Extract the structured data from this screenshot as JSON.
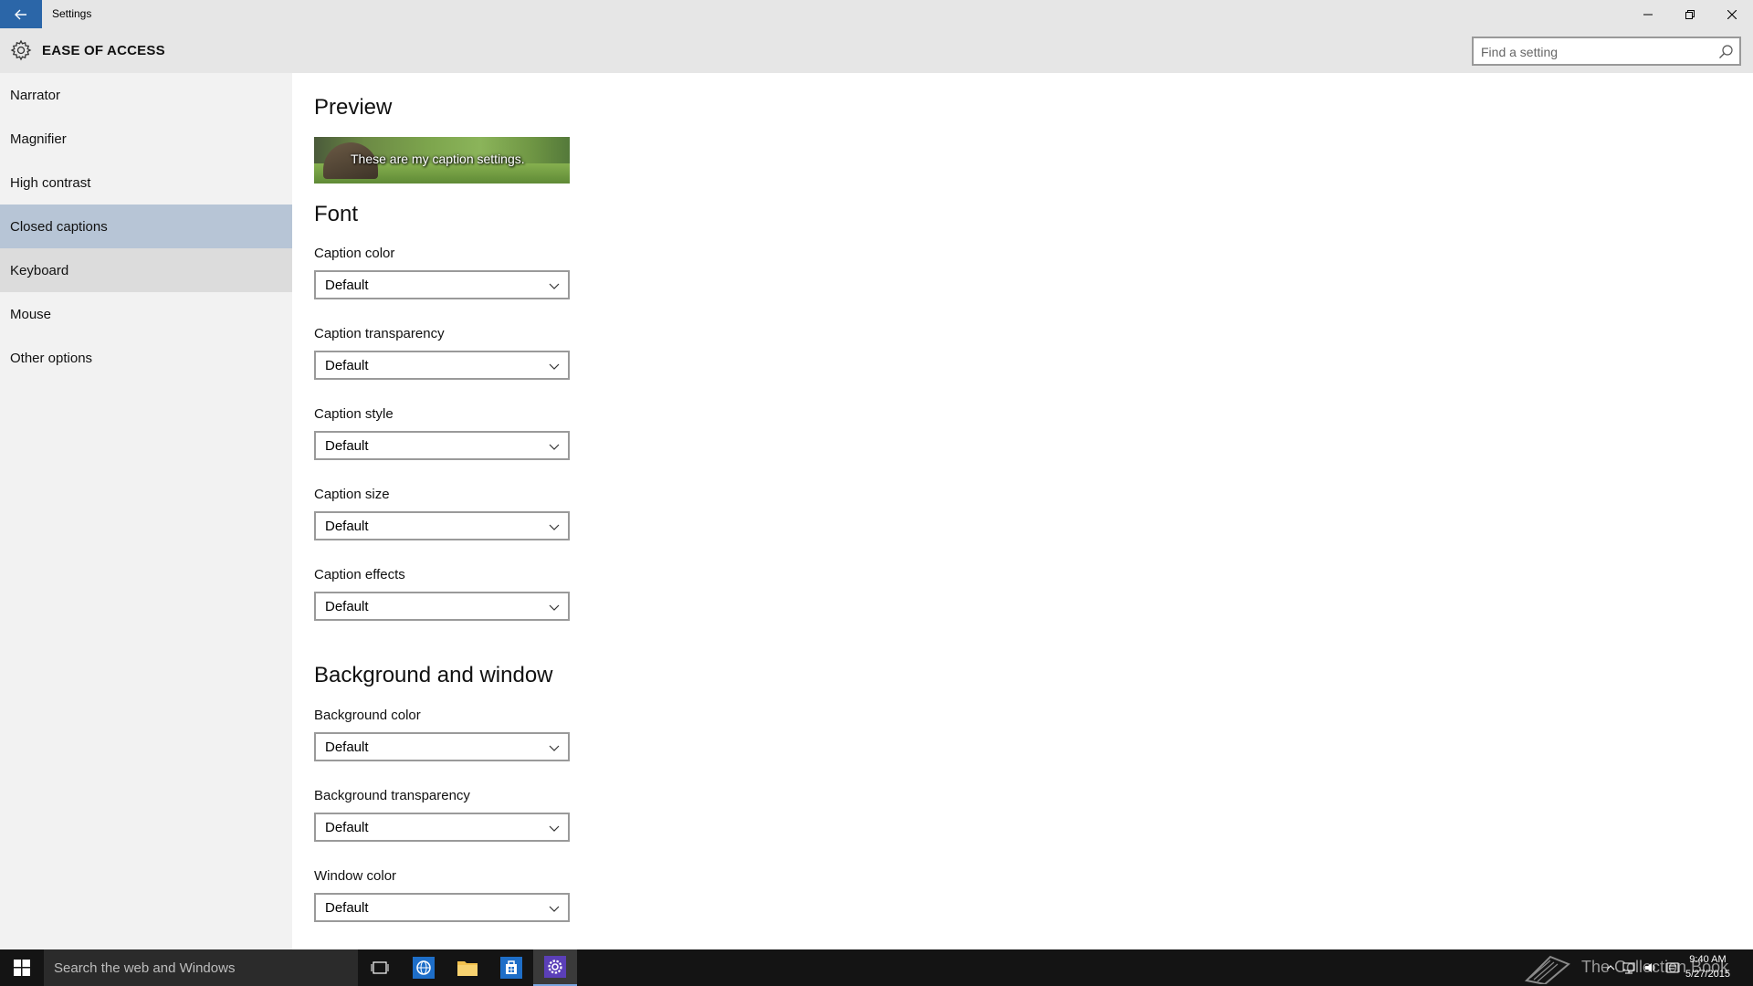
{
  "window": {
    "title": "Settings",
    "back_icon": "back-arrow-icon",
    "controls": [
      "minimize-icon",
      "restore-icon",
      "close-icon"
    ]
  },
  "header": {
    "section_title": "EASE OF ACCESS",
    "icon": "gear-icon",
    "search_placeholder": "Find a setting"
  },
  "sidebar": {
    "items": [
      {
        "label": "Narrator"
      },
      {
        "label": "Magnifier"
      },
      {
        "label": "High contrast"
      },
      {
        "label": "Closed captions",
        "selected": true
      },
      {
        "label": "Keyboard",
        "hover": true
      },
      {
        "label": "Mouse"
      },
      {
        "label": "Other options"
      }
    ]
  },
  "main": {
    "preview_heading": "Preview",
    "preview_caption": "These are my caption settings.",
    "font_heading": "Font",
    "font_fields": [
      {
        "label": "Caption color",
        "value": "Default"
      },
      {
        "label": "Caption transparency",
        "value": "Default"
      },
      {
        "label": "Caption style",
        "value": "Default"
      },
      {
        "label": "Caption size",
        "value": "Default"
      },
      {
        "label": "Caption effects",
        "value": "Default"
      }
    ],
    "background_heading": "Background and window",
    "background_fields": [
      {
        "label": "Background color",
        "value": "Default"
      },
      {
        "label": "Background transparency",
        "value": "Default"
      },
      {
        "label": "Window color",
        "value": "Default"
      }
    ]
  },
  "taskbar": {
    "search_text": "Search the web and Windows",
    "watermark": "The Collection Book",
    "time": "9:40 AM",
    "date": "5/27/2015",
    "accent": "#2b66a8"
  }
}
